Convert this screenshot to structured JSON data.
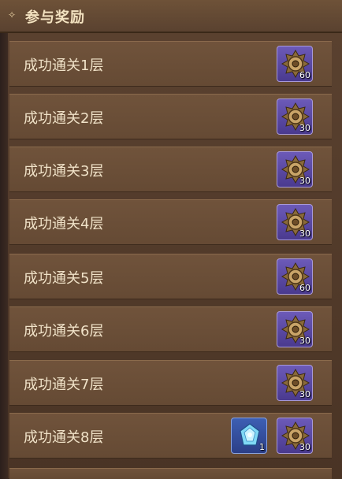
{
  "header": {
    "title": "参与奖励"
  },
  "rows": [
    {
      "label": "成功通关1层",
      "rewards": [
        {
          "icon": "bronze-coin-icon",
          "count": "60"
        }
      ]
    },
    {
      "label": "成功通关2层",
      "rewards": [
        {
          "icon": "bronze-coin-icon",
          "count": "30"
        }
      ]
    },
    {
      "label": "成功通关3层",
      "rewards": [
        {
          "icon": "bronze-coin-icon",
          "count": "30"
        }
      ]
    },
    {
      "label": "成功通关4层",
      "rewards": [
        {
          "icon": "bronze-coin-icon",
          "count": "30"
        }
      ]
    },
    {
      "label": "成功通关5层",
      "rewards": [
        {
          "icon": "bronze-coin-icon",
          "count": "60"
        }
      ]
    },
    {
      "label": "成功通关6层",
      "rewards": [
        {
          "icon": "bronze-coin-icon",
          "count": "30"
        }
      ]
    },
    {
      "label": "成功通关7层",
      "rewards": [
        {
          "icon": "bronze-coin-icon",
          "count": "30"
        }
      ]
    },
    {
      "label": "成功通关8层",
      "rewards": [
        {
          "icon": "blue-crystal-icon",
          "count": "1"
        },
        {
          "icon": "bronze-coin-icon",
          "count": "30"
        }
      ]
    }
  ],
  "colors": {
    "panel": "#5b4230",
    "row": "#6a4e37",
    "text": "#f0e2c8",
    "reward_purple": "#5a48a0",
    "reward_blue": "#3a55a8"
  }
}
